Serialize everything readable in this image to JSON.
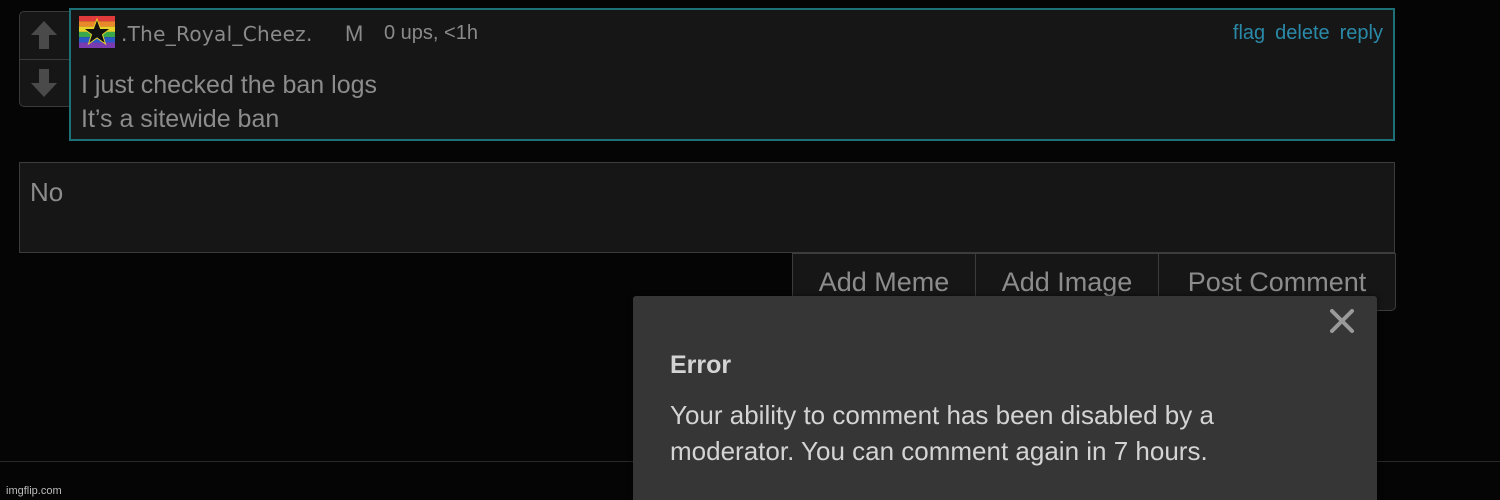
{
  "comment": {
    "username": ".The_Royal_Cheez.",
    "badge": "M",
    "meta": "0 ups, <1h",
    "actions": {
      "flag": "flag",
      "delete": "delete",
      "reply": "reply"
    },
    "lines": [
      "I just checked the ban logs",
      "It’s a sitewide ban"
    ],
    "icons": {
      "upvote": "arrow-up-icon",
      "downvote": "arrow-down-icon",
      "avatar": "rainbow-star-avatar"
    }
  },
  "reply": {
    "value": "No"
  },
  "buttons": {
    "add_meme": "Add Meme",
    "add_image": "Add Image",
    "post_comment": "Post Comment"
  },
  "dialog": {
    "title": "Error",
    "message": "Your ability to comment has been disabled by a moderator. You can comment again in 7 hours.",
    "close_icon": "close-icon"
  },
  "footer": {
    "watermark": "imgflip.com"
  },
  "colors": {
    "background": "#050505",
    "panel": "#161616",
    "accent_border": "#1d6f78",
    "link": "#2a8aa8",
    "dialog_bg": "#363636",
    "dialog_text": "#d4d4d4"
  }
}
